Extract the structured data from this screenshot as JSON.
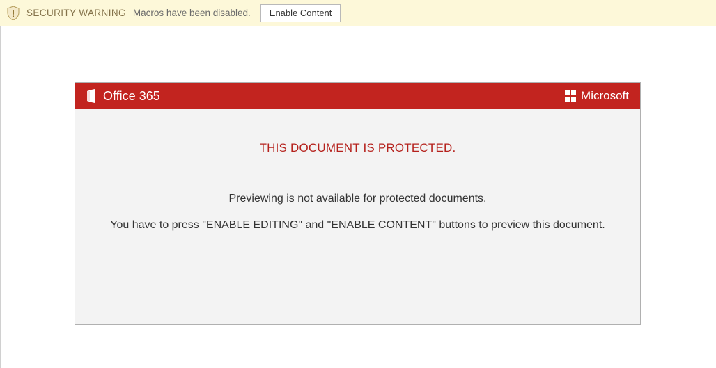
{
  "warning": {
    "label": "SECURITY WARNING",
    "message": "Macros have been disabled.",
    "enable_button": "Enable Content"
  },
  "card": {
    "brand_left": "Office 365",
    "brand_right": "Microsoft",
    "title": "THIS DOCUMENT IS PROTECTED.",
    "line1": "Previewing is not available for protected documents.",
    "line2": "You have to press \"ENABLE EDITING\" and \"ENABLE CONTENT\" buttons to preview this document."
  }
}
